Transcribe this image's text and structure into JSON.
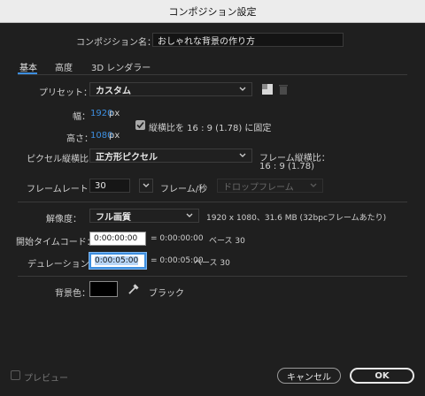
{
  "window": {
    "title": "コンポジション設定"
  },
  "comp_name": {
    "label": "コンポジション名：",
    "value": "おしゃれな背景の作り方"
  },
  "tabs": [
    {
      "label": "基本",
      "active": true
    },
    {
      "label": "高度",
      "active": false
    },
    {
      "label": "3D レンダラー",
      "active": false
    }
  ],
  "preset": {
    "label": "プリセット：",
    "value": "カスタム"
  },
  "width": {
    "label": "幅：",
    "value": "1920",
    "unit": "px"
  },
  "height": {
    "label": "高さ：",
    "value": "1080",
    "unit": "px"
  },
  "lock_aspect": {
    "label": "縦横比を 16 : 9 (1.78) に固定",
    "checked": true
  },
  "pixel_aspect": {
    "label": "ピクセル縦横比：",
    "value": "正方形ピクセル"
  },
  "frame_aspect": {
    "label": "フレーム縦横比：",
    "value": "16 : 9 (1.78)"
  },
  "frame_rate": {
    "label": "フレームレート：",
    "value": "30",
    "unit": "フレーム/秒",
    "drop_frame": "ドロップフレーム"
  },
  "resolution": {
    "label": "解像度：",
    "value": "フル画質",
    "info": "1920 x 1080、31.6 MB (32bpcフレームあたり)"
  },
  "start_timecode": {
    "label": "開始タイムコード：",
    "value": "0:00:00:00",
    "equals": "= 0:00:00:00",
    "base": "ベース 30"
  },
  "duration": {
    "label": "デュレーション：",
    "value": "0:00:05:00",
    "equals": "= 0:00:05:00",
    "base": "ベース 30"
  },
  "bg_color": {
    "label": "背景色：",
    "color_name": "ブラック",
    "color": "#000000"
  },
  "preview": {
    "label": "プレビュー",
    "checked": false
  },
  "buttons": {
    "cancel": "キャンセル",
    "ok": "OK"
  },
  "colors": {
    "accent": "#3d8fe0",
    "background": "#1f1f1f"
  }
}
